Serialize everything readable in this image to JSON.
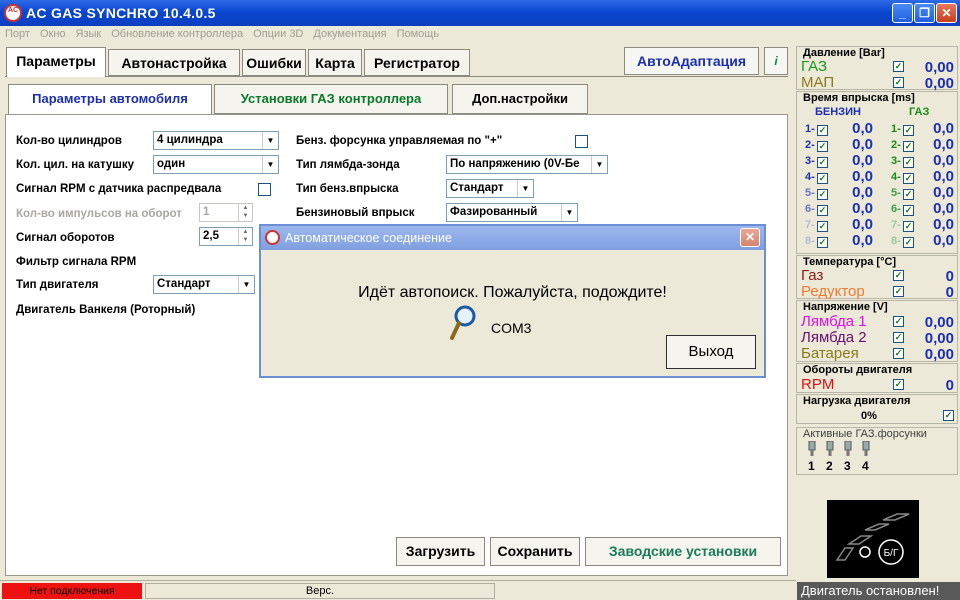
{
  "window": {
    "title": "AC GAS SYNCHRO  10.4.0.5"
  },
  "menu": [
    "Порт",
    "Окно",
    "Язык",
    "Обновление контроллера",
    "Опции 3D",
    "Документация",
    "Помощь"
  ],
  "main_tabs": [
    "Параметры",
    "Автонастройка",
    "Ошибки",
    "Карта",
    "Регистратор"
  ],
  "autoadapt_label": "АвтоАдаптация",
  "info_label": "i",
  "sub_tabs": [
    "Параметры автомобиля",
    "Установки ГАЗ контроллера",
    "Доп.настройки"
  ],
  "params": {
    "cyl_label": "Кол-во цилиндров",
    "cyl_value": "4 цилиндра",
    "coil_label": "Кол. цил. на катушку",
    "coil_value": "один",
    "rpm_cam_label": "Сигнал RPM с датчика распредвала",
    "pulses_label": "Кол-во импульсов на оборот",
    "pulses_value": "1",
    "rpm_sig_label": "Сигнал оборотов",
    "rpm_sig_value": "2,5",
    "rpm_filter_label": "Фильтр сигнала RPM",
    "engine_type_label": "Тип двигателя",
    "engine_type_value": "Стандарт",
    "wankel_label": "Двигатель Ванкеля (Роторный)",
    "petrol_inj_plus_label": "Бенз. форсунка управляемая по \"+\"",
    "lambda_type_label": "Тип лямбда-зонда",
    "lambda_type_value": "По напряжению  (0V-Бе",
    "petrol_inj_type_label": "Тип бенз.впрыска",
    "petrol_inj_type_value": "Стандарт",
    "petrol_injection_label": "Бензиновый впрыск",
    "petrol_injection_value": "Фазированный"
  },
  "buttons": {
    "load": "Загрузить",
    "save": "Сохранить",
    "factory": "Заводские установки"
  },
  "dialog": {
    "title": "Автоматическое соединение",
    "message": "Идёт автопоиск. Пожалуйста, подождите!",
    "port": "COM3",
    "exit": "Выход"
  },
  "right": {
    "pressure_title": "Давление [Bar]",
    "gas_label": "ГАЗ",
    "gas_value": "0,00",
    "map_label": "МАП",
    "map_value": "0,00",
    "injtime_title": "Время впрыска [ms]",
    "petrol_col": "БЕНЗИН",
    "gas_col": "ГАЗ",
    "inj_rows": [
      {
        "n": "1-",
        "p": "0,0",
        "g": "0,0",
        "color": "#1b2fb0",
        "gcolor": "#1a8a1a"
      },
      {
        "n": "2-",
        "p": "0,0",
        "g": "0,0",
        "color": "#1b2fb0",
        "gcolor": "#1a8a1a"
      },
      {
        "n": "3-",
        "p": "0,0",
        "g": "0,0",
        "color": "#1b2fb0",
        "gcolor": "#1a8a1a"
      },
      {
        "n": "4-",
        "p": "0,0",
        "g": "0,0",
        "color": "#1b2fb0",
        "gcolor": "#1a8a1a"
      },
      {
        "n": "5-",
        "p": "0,0",
        "g": "0,0",
        "color": "#6a72c8",
        "gcolor": "#3aa04a"
      },
      {
        "n": "6-",
        "p": "0,0",
        "g": "0,0",
        "color": "#6a72c8",
        "gcolor": "#3aa04a"
      },
      {
        "n": "7-",
        "p": "0,0",
        "g": "0,0",
        "color": "#b8b8d8",
        "gcolor": "#a0c8a0"
      },
      {
        "n": "8-",
        "p": "0,0",
        "g": "0,0",
        "color": "#b8b8d8",
        "gcolor": "#a0c8a0"
      }
    ],
    "inj_gas_nums": [
      "1-",
      "2-",
      "3-",
      "4-",
      "5-",
      "6-",
      "7-",
      "8-"
    ],
    "temp_title": "Температура  [°C]",
    "temp_gas_label": "Газ",
    "temp_gas_value": "0",
    "temp_red_label": "Редуктор",
    "temp_red_value": "0",
    "volt_title": "Напряжение [V]",
    "lambda1_label": "Лямбда 1",
    "lambda1_value": "0,00",
    "lambda2_label": "Лямбда 2",
    "lambda2_value": "0,00",
    "battery_label": "Батарея",
    "battery_value": "0,00",
    "rpm_title": "Обороты двигателя",
    "rpm_label": "RPM",
    "rpm_value": "0",
    "load_title": "Нагрузка двигателя",
    "load_value": "0%",
    "active_title": "Активные ГАЗ.форсунки",
    "active_nums": [
      "1",
      "2",
      "3",
      "4"
    ],
    "engine_badge": "Б/Г",
    "engine_status": "Двигатель остановлен!"
  },
  "status": {
    "connection": "Нет подключения",
    "version": "Верс."
  },
  "colors": {
    "gas": "#1a9a1a",
    "map": "#8a7a1a",
    "temp_gas": "#8a1a1a",
    "reducer": "#f07a30",
    "lambda1": "#e010e0",
    "lambda2": "#6a1070",
    "battery": "#8a7a1a",
    "rpm": "#e01010"
  }
}
